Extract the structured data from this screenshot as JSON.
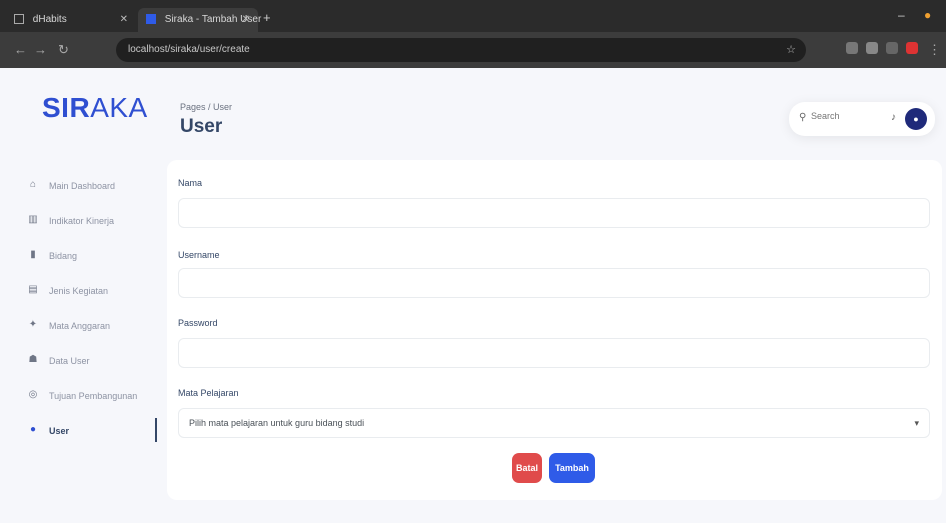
{
  "browser": {
    "tabs": [
      {
        "label": "dHabits",
        "active": false
      },
      {
        "label": "Siraka - Tambah User",
        "active": true
      }
    ],
    "new_tab": "+",
    "url": "localhost/siraka/user/create",
    "url_icons": "☆"
  },
  "sidebar": {
    "logo_part1": "SIR",
    "logo_part2": "AKA",
    "items": [
      {
        "label": "Main Dashboard",
        "icon": "home-icon",
        "glyph": "⌂",
        "active": false
      },
      {
        "label": "Indikator Kinerja",
        "icon": "chart-icon",
        "glyph": "▥",
        "active": false
      },
      {
        "label": "Bidang",
        "icon": "building-icon",
        "glyph": "▮",
        "active": false
      },
      {
        "label": "Jenis Kegiatan",
        "icon": "list-icon",
        "glyph": "▤",
        "active": false
      },
      {
        "label": "Mata Anggaran",
        "icon": "wallet-icon",
        "glyph": "✦",
        "active": false
      },
      {
        "label": "Data User",
        "icon": "users-icon",
        "glyph": "☗",
        "active": false
      },
      {
        "label": "Tujuan Pembangunan",
        "icon": "target-icon",
        "glyph": "◎",
        "active": false
      },
      {
        "label": "User",
        "icon": "user-icon",
        "glyph": "●",
        "active": true
      }
    ]
  },
  "header": {
    "breadcrumb": "Pages / User",
    "title": "User",
    "search_placeholder": "Search"
  },
  "form": {
    "name_label": "Nama",
    "username_label": "Username",
    "password_label": "Password",
    "role_label": "Mata Pelajaran",
    "role_value": "Pilih mata pelajaran untuk guru bidang studi",
    "back_label": "Batal",
    "submit_label": "Tambah"
  },
  "colors": {
    "accent": "#2f5be8",
    "danger": "#e04b4b",
    "title": "#344767"
  }
}
